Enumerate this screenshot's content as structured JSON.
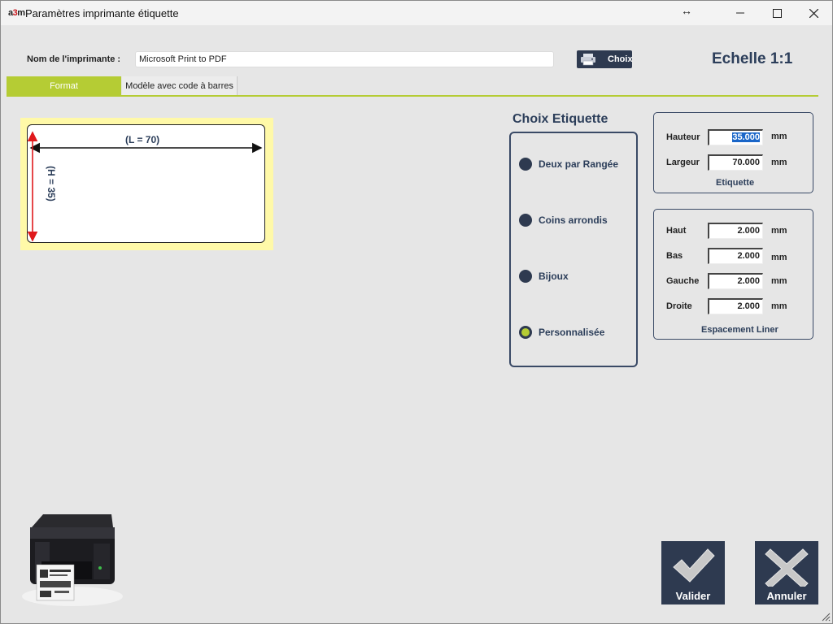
{
  "window": {
    "app_logo_a": "a",
    "app_logo_3": "3",
    "app_logo_m": "m",
    "title": "Paramètres imprimante étiquette",
    "resize_glyph": "↔"
  },
  "printer": {
    "label": "Nom de l'imprimante :",
    "value": "Microsoft Print to PDF",
    "choose_button": "Choix",
    "scale": "Echelle 1:1"
  },
  "tabs": [
    {
      "label": "Format",
      "active": true
    },
    {
      "label": "Modèle avec code à barres",
      "active": false
    }
  ],
  "preview": {
    "width_label": "(L = 70)",
    "height_label": "(H = 35)"
  },
  "label_choice": {
    "title": "Choix Etiquette",
    "options": [
      {
        "label": "Deux par Rangée",
        "selected": false
      },
      {
        "label": "Coins arrondis",
        "selected": false
      },
      {
        "label": "Bijoux",
        "selected": false
      },
      {
        "label": "Personnalisée",
        "selected": true
      }
    ]
  },
  "label_size": {
    "caption": "Etiquette",
    "fields": [
      {
        "label": "Hauteur",
        "value": "35.000",
        "unit": "mm"
      },
      {
        "label": "Largeur",
        "value": "70.000",
        "unit": "mm"
      }
    ]
  },
  "liner_spacing": {
    "caption": "Espacement Liner",
    "fields": [
      {
        "label": "Haut",
        "value": "2.000",
        "unit": "mm"
      },
      {
        "label": "Bas",
        "value": "2.000",
        "unit": "mm"
      },
      {
        "label": "Gauche",
        "value": "2.000",
        "unit": "mm"
      },
      {
        "label": "Droite",
        "value": "2.000",
        "unit": "mm"
      }
    ]
  },
  "actions": {
    "validate": "Valider",
    "cancel": "Annuler"
  },
  "colors": {
    "accent_green": "#b5cc34",
    "navy": "#2e3a50",
    "preview_yellow": "#fff9a8",
    "arrow_red": "#e0191c"
  }
}
